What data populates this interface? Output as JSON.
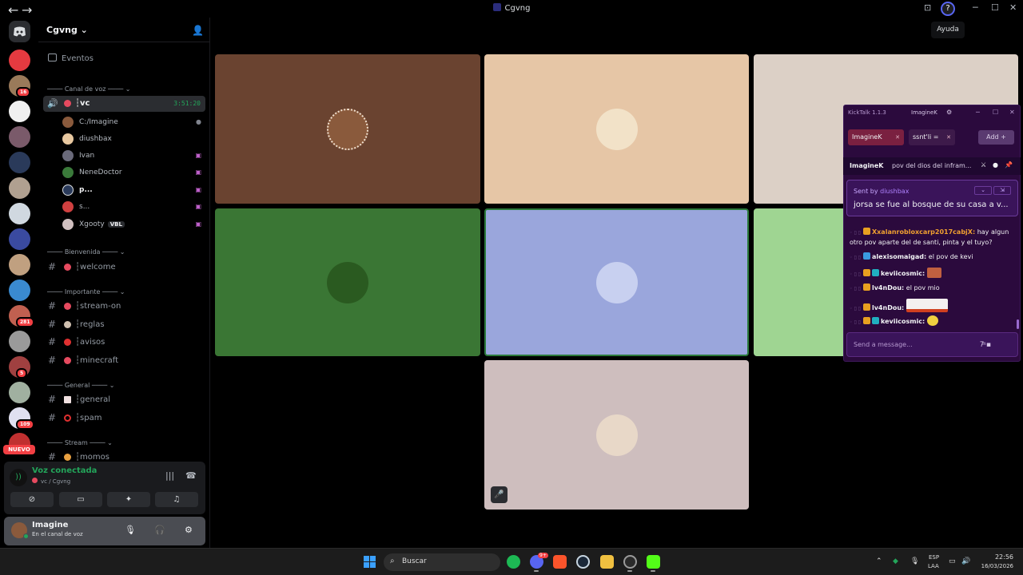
{
  "window": {
    "title": "Cgvng",
    "back": "←",
    "forward": "→",
    "minimize": "─",
    "maximize": "☐",
    "close": "✕",
    "inbox_icon": "⊡",
    "help_icon": "?"
  },
  "tooltip": "Ayuda",
  "rail": {
    "badges": [
      "16",
      "281",
      "5",
      "109"
    ],
    "nuevo": "NUEVO"
  },
  "server": {
    "name": "Cgvng",
    "chevron": "⌄",
    "events": "Eventos"
  },
  "categories": {
    "voice": "Canal de voz",
    "welcome": "Bienvenida",
    "important": "Importante",
    "general": "General",
    "stream": "Stream"
  },
  "voice_channel": {
    "name": "┆vc",
    "timer": "3:51:20"
  },
  "members": [
    {
      "name": "C:/Imagine"
    },
    {
      "name": "diushbax"
    },
    {
      "name": "Ivan"
    },
    {
      "name": "NeneDoctor"
    },
    {
      "name": "p..."
    },
    {
      "name": "s..."
    },
    {
      "name": "Xgooty",
      "tag": "VBL"
    }
  ],
  "channels": {
    "welcome": "┆welcome",
    "stream_on": "┆stream-on",
    "reglas": "┆reglas",
    "avisos": "┆avisos",
    "minecraft": "┆minecraft",
    "general": "┆general",
    "spam": "┆spam",
    "momos": "┆momos"
  },
  "voice_panel": {
    "status": "Voz conectada",
    "location": "vc / Cgvng"
  },
  "user": {
    "name": "Imagine",
    "status": "En el canal de voz"
  },
  "kicktalk": {
    "title": "KickTalk 1.1.3",
    "user": "ImagineK",
    "tabs": [
      "ImagineK",
      "ssnt'li ="
    ],
    "add": "Add +",
    "pin_user": "ImagineK",
    "pin_text": "pov del dios del infram...",
    "sent_by_label": "Sent by",
    "sent_by_user": "diushbax",
    "pinned_message": "jorsa se fue al bosque de su casa a v...",
    "messages": [
      {
        "user": "Xxalanrobloxcarp2017cabjX:",
        "text": "hay algun otro pov aparte del de santi, pinta y el tuyo?"
      },
      {
        "user": "alexisomaigad:",
        "text": "el pov de kevi"
      },
      {
        "user": "keviicosmic:",
        "text": ""
      },
      {
        "user": "lv4nDou:",
        "text": "el pov mio"
      },
      {
        "user": "lv4nDou:",
        "text": ""
      },
      {
        "user": "keviicosmic:",
        "text": ""
      }
    ],
    "input_placeholder": "Send a message..."
  },
  "taskbar": {
    "search": "Buscar",
    "discord_badge": "9+",
    "lang1": "ESP",
    "lang2": "LAA",
    "time": "22:56",
    "date": "16/03/2026"
  }
}
